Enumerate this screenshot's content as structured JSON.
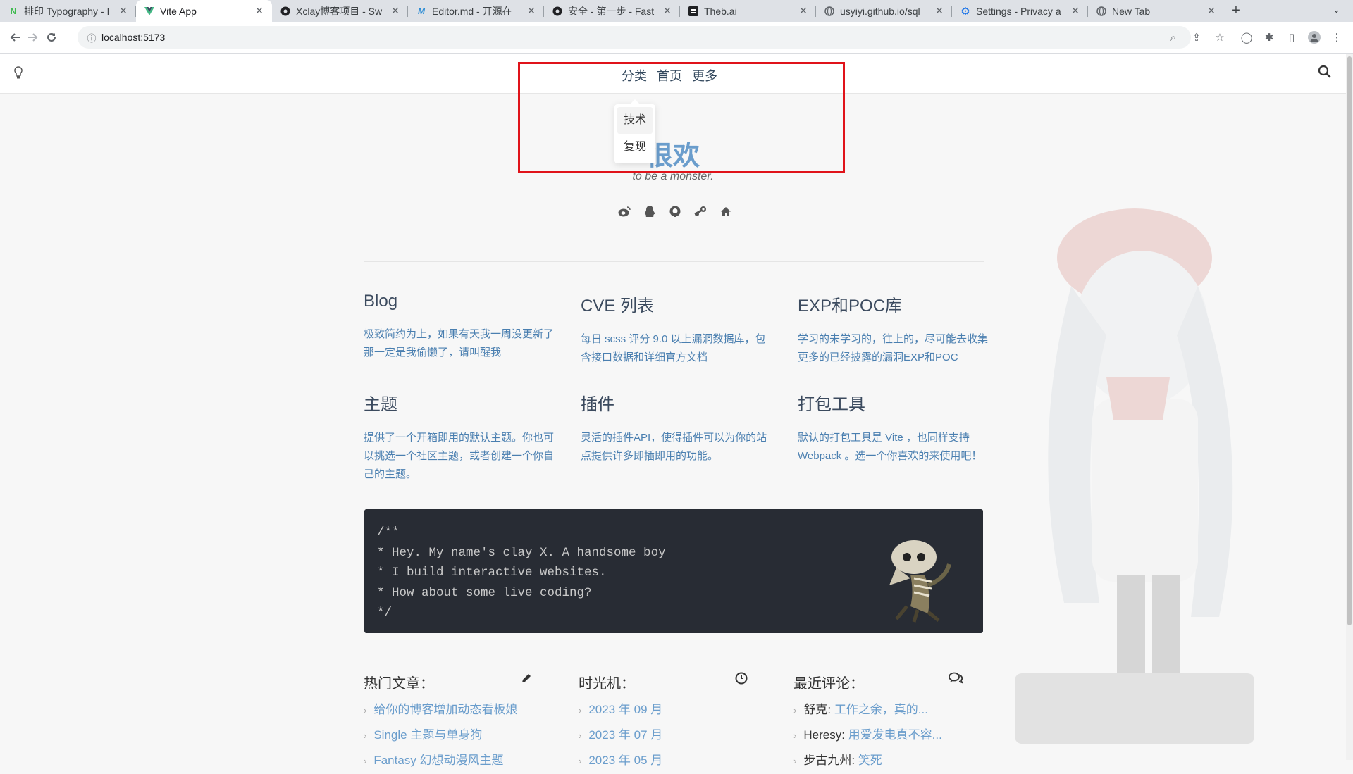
{
  "browser": {
    "tabs": [
      {
        "title": "排印 Typography - I",
        "icon": "n-icon",
        "icon_color": "#3dba4e",
        "active": false
      },
      {
        "title": "Vite App",
        "icon": "vue-icon",
        "icon_color": "#41b883",
        "active": true
      },
      {
        "title": "Xclay博客项目 - Sw",
        "icon": "github-icon",
        "icon_color": "#202124",
        "active": false
      },
      {
        "title": "Editor.md - 开源在",
        "icon": "m-icon",
        "icon_color": "#2a8bd4",
        "active": false
      },
      {
        "title": "安全 - 第一步 - Fast",
        "icon": "github-icon",
        "icon_color": "#202124",
        "active": false
      },
      {
        "title": "Theb.ai",
        "icon": "thebai-icon",
        "icon_color": "#202124",
        "active": false
      },
      {
        "title": "usyiyi.github.io/sql",
        "icon": "globe-icon",
        "icon_color": "#5f6368",
        "active": false
      },
      {
        "title": "Settings - Privacy a",
        "icon": "settings-icon",
        "icon_color": "#1a73e8",
        "active": false
      },
      {
        "title": "New Tab",
        "icon": "globe-icon",
        "icon_color": "#5f6368",
        "active": false
      }
    ],
    "new_tab_label": "+",
    "url": "localhost:5173"
  },
  "nav": {
    "links": [
      "分类",
      "首页",
      "更多"
    ],
    "dropdown": [
      "技术",
      "复现"
    ]
  },
  "hero": {
    "title": "很欢",
    "subtitle": "to be a monster."
  },
  "socials": [
    "weibo-icon",
    "qq-icon",
    "github-icon",
    "steam-icon",
    "home-icon"
  ],
  "features": [
    {
      "title": "Blog",
      "desc": "极致简约为上，如果有天我一周没更新了那一定是我偷懒了，请叫醒我"
    },
    {
      "title": "CVE 列表",
      "desc": "每日 scss 评分 9.0 以上漏洞数据库，包含接口数据和详细官方文档"
    },
    {
      "title": "EXP和POC库",
      "desc": "学习的未学习的，往上的，尽可能去收集更多的已经披露的漏洞EXP和POC"
    },
    {
      "title": "主题",
      "desc": "提供了一个开箱即用的默认主题。你也可以挑选一个社区主题，或者创建一个你自己的主题。"
    },
    {
      "title": "插件",
      "desc": "灵活的插件API，使得插件可以为你的站点提供许多即插即用的功能。"
    },
    {
      "title": "打包工具",
      "desc": "默认的打包工具是 Vite ，也同样支持 Webpack 。选一个你喜欢的来使用吧！"
    }
  ],
  "code": {
    "lines": [
      "/**",
      "* Hey. My name's clay X. A handsome boy",
      "* I build interactive websites.",
      "* How about some live coding?",
      "*/"
    ]
  },
  "footer": {
    "popular": {
      "title": "热门文章：",
      "items": [
        "给你的博客增加动态看板娘",
        "Single 主题与单身狗",
        "Fantasy 幻想动漫风主题"
      ]
    },
    "timeline": {
      "title": "时光机：",
      "items": [
        "2023 年 09 月",
        "2023 年 07 月",
        "2023 年 05 月"
      ]
    },
    "comments": {
      "title": "最近评论：",
      "items": [
        {
          "who": "舒克:",
          "text": "工作之余，真的..."
        },
        {
          "who": "Heresy:",
          "text": "用爱发电真不容..."
        },
        {
          "who": "步古九州:",
          "text": "笑死"
        }
      ]
    }
  },
  "colors": {
    "accent": "#6a9dcc",
    "code_bg": "#282c34",
    "highlight_box": "#e0131a"
  }
}
